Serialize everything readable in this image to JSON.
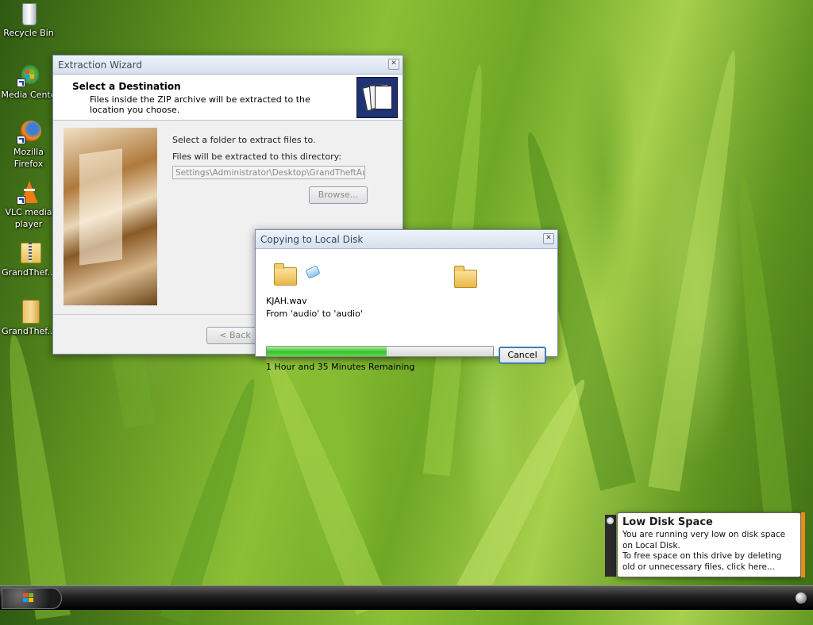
{
  "desktop": {
    "icons": [
      {
        "label": "Recycle Bin",
        "icon": "recycle-bin-icon"
      },
      {
        "label": "Media Cente",
        "icon": "media-center-icon"
      },
      {
        "label": "Mozilla Firefox",
        "icon": "firefox-icon"
      },
      {
        "label": "VLC media player",
        "icon": "vlc-icon"
      },
      {
        "label": "GrandThef...",
        "icon": "zip-folder-icon"
      },
      {
        "label": "GrandThef...",
        "icon": "folder-icon"
      }
    ]
  },
  "wizard": {
    "title": "Extraction Wizard",
    "heading": "Select a Destination",
    "subtitle": "Files inside the ZIP archive will be extracted to the location you choose.",
    "prompt": "Select a folder to extract files to.",
    "dir_label": "Files will be extracted to this directory:",
    "dir_value": "Settings\\Administrator\\Desktop\\GrandTheftAutoIII",
    "browse_label": "Browse...",
    "back_label": "< Back",
    "logo_icon": "folder-files-icon"
  },
  "copy_dialog": {
    "title": "Copying to Local Disk",
    "filename": "KJAH.wav",
    "from_to": "From 'audio' to 'audio'",
    "progress": 0.53,
    "remaining": "1 Hour and 35 Minutes Remaining",
    "cancel_label": "Cancel"
  },
  "notification": {
    "title": "Low Disk Space",
    "line1": "You are running very low on disk space on Local Disk.",
    "line2": "To free space on this drive by deleting old or unnecessary files, click here..."
  },
  "colors": {
    "progress": "#38c22a",
    "balloon_accent": "#e88b1c",
    "wizard_logo_bg": "#1f3373"
  }
}
